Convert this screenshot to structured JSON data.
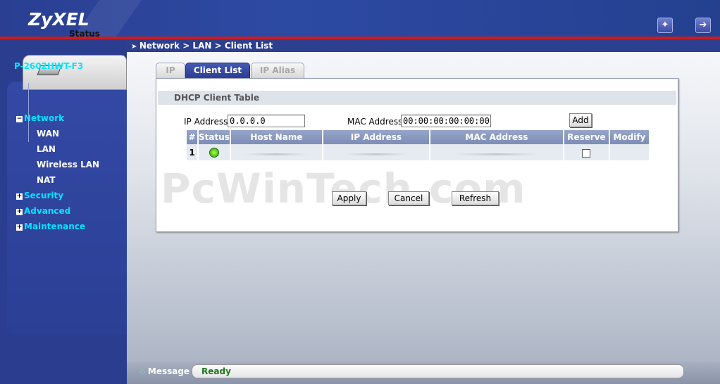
{
  "header": {
    "logo": "ZyXEL",
    "wizard_icon": "wizard-icon",
    "logout_icon": "logout-icon"
  },
  "sidebar": {
    "status_label": "Status",
    "model": "P-2602HWT-F3",
    "items": [
      {
        "label": "Network",
        "expander": "⊟"
      },
      {
        "label": "WAN"
      },
      {
        "label": "LAN"
      },
      {
        "label": "Wireless LAN"
      },
      {
        "label": "NAT"
      },
      {
        "label": "Security",
        "expander": "⊞"
      },
      {
        "label": "Advanced",
        "expander": "⊞"
      },
      {
        "label": "Maintenance",
        "expander": "⊞"
      }
    ]
  },
  "breadcrumb": "Network > LAN > Client List",
  "tabs": [
    {
      "label": "IP",
      "active": false
    },
    {
      "label": "Client List",
      "active": true
    },
    {
      "label": "IP Alias",
      "active": false
    }
  ],
  "section_title": "DHCP Client Table",
  "form": {
    "ip_label": "IP Address",
    "ip_value": "0.0.0.0",
    "mac_label": "MAC Address",
    "mac_value": "00:00:00:00:00:00",
    "add_label": "Add"
  },
  "table": {
    "columns": [
      "#",
      "Status",
      "Host Name",
      "IP Address",
      "MAC Address",
      "Reserve",
      "Modify"
    ],
    "rows": [
      {
        "num": "1",
        "status_icon": "bulb-icon",
        "host_name": "",
        "ip_address": "",
        "mac_address": "",
        "reserve": false,
        "modify": ""
      }
    ]
  },
  "buttons": {
    "apply": "Apply",
    "cancel": "Cancel",
    "refresh": "Refresh"
  },
  "watermark": "PcWinTech.com",
  "message": {
    "label": "Message",
    "text": "Ready",
    "text_color": "#1b7a1b"
  },
  "colors": {
    "header_blue": "#2a3f92",
    "accent_red": "#d01a1a",
    "nav_cyan": "#00e5ff"
  }
}
